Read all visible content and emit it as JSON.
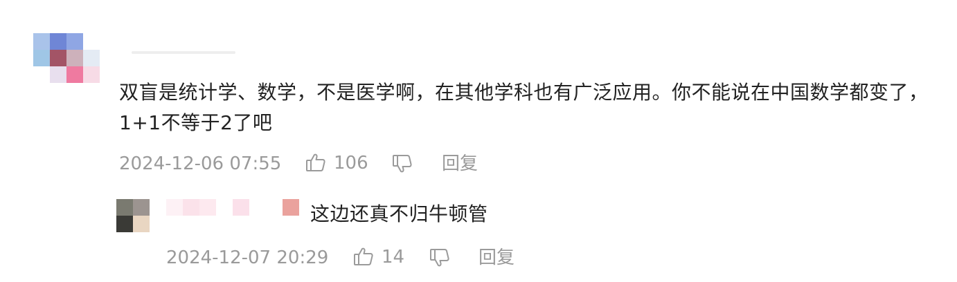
{
  "comment": {
    "text": "双盲是统计学、数学，不是医学啊，在其他学科也有广泛应用。你不能说在中国数学都变了，1+1不等于2了吧",
    "timestamp": "2024-12-06 07:55",
    "like_count": "106",
    "reply_label": "回复",
    "icons": {
      "like": "thumbs-up-icon",
      "dislike": "thumbs-down-icon"
    }
  },
  "reply": {
    "text": "这边还真不归牛顿管",
    "timestamp": "2024-12-07 20:29",
    "like_count": "14",
    "reply_label": "回复",
    "icons": {
      "like": "thumbs-up-icon",
      "dislike": "thumbs-down-icon"
    }
  },
  "colors": {
    "text": "#222222",
    "meta": "#9a9a9a",
    "background": "#ffffff"
  }
}
